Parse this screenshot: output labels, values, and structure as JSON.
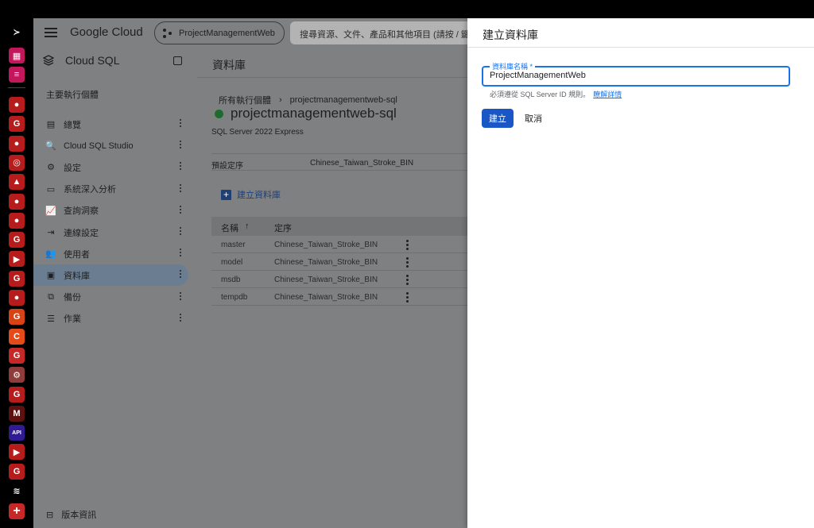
{
  "dock": {
    "items": [
      {
        "name": "sidebar-toggle-icon",
        "glyph": "≻",
        "bg": "#000000"
      },
      {
        "name": "apps-grid-icon",
        "glyph": "▦",
        "bg": "#c2185b"
      },
      {
        "name": "search-list-icon",
        "glyph": "≡",
        "bg": "#c2185b"
      },
      {
        "name": "github-icon",
        "glyph": "●",
        "bg": "#b71c1c"
      },
      {
        "name": "google-icon",
        "glyph": "G",
        "bg": "#b71c1c"
      },
      {
        "name": "github-icon",
        "glyph": "●",
        "bg": "#b71c1c"
      },
      {
        "name": "globe-icon",
        "glyph": "◎",
        "bg": "#b71c1c"
      },
      {
        "name": "cloud-drive-icon",
        "glyph": "▲",
        "bg": "#b71c1c"
      },
      {
        "name": "github-icon",
        "glyph": "●",
        "bg": "#b71c1c"
      },
      {
        "name": "github-icon",
        "glyph": "●",
        "bg": "#b71c1c"
      },
      {
        "name": "google-icon",
        "glyph": "G",
        "bg": "#b71c1c"
      },
      {
        "name": "youtube-icon",
        "glyph": "▶",
        "bg": "#b71c1c"
      },
      {
        "name": "google-icon",
        "glyph": "G",
        "bg": "#b71c1c"
      },
      {
        "name": "github-icon",
        "glyph": "●",
        "bg": "#b71c1c"
      },
      {
        "name": "g-app-icon",
        "glyph": "G",
        "bg": "#d84315"
      },
      {
        "name": "c-app-icon",
        "glyph": "C",
        "bg": "#e64a19"
      },
      {
        "name": "g-app-icon",
        "glyph": "G",
        "bg": "#c62828"
      },
      {
        "name": "settings-icon",
        "glyph": "⚙",
        "bg": "#8d3b3b"
      },
      {
        "name": "google-icon",
        "glyph": "G",
        "bg": "#b71c1c"
      },
      {
        "name": "medium-icon",
        "glyph": "M",
        "bg": "#5d1010"
      },
      {
        "name": "api-icon",
        "glyph": "API",
        "bg": "#311b92"
      },
      {
        "name": "youtube-icon",
        "glyph": "▶",
        "bg": "#b71c1c"
      },
      {
        "name": "google-icon",
        "glyph": "G",
        "bg": "#b71c1c"
      },
      {
        "name": "cloud-sql-icon",
        "glyph": "≋",
        "bg": "#000000"
      }
    ],
    "add_label": "+"
  },
  "topbar": {
    "brand": "Google Cloud",
    "project": "ProjectManagementWeb",
    "search_placeholder": "搜尋資源、文件、產品和其他項目 (請按 / 鍵)"
  },
  "sidenav": {
    "title": "Cloud SQL",
    "section": "主要執行個體",
    "items": [
      {
        "label": "總覽",
        "icon": "▤"
      },
      {
        "label": "Cloud SQL Studio",
        "icon": "🔍"
      },
      {
        "label": "設定",
        "icon": "⚙"
      },
      {
        "label": "系統深入分析",
        "icon": "▭"
      },
      {
        "label": "查詢洞察",
        "icon": "📈"
      },
      {
        "label": "連線設定",
        "icon": "⇥"
      },
      {
        "label": "使用者",
        "icon": "👥"
      },
      {
        "label": "資料庫",
        "icon": "▣"
      },
      {
        "label": "備份",
        "icon": "⧉"
      },
      {
        "label": "作業",
        "icon": "☰"
      }
    ],
    "active_index": 7,
    "footer": "版本資訊"
  },
  "main": {
    "header": "資料庫",
    "breadcrumb_root": "所有執行個體",
    "breadcrumb_sep": "›",
    "breadcrumb_current": "projectmanagementweb-sql",
    "instance_name": "projectmanagementweb-sql",
    "edition": "SQL Server 2022 Express",
    "default_collation_label": "預設定序",
    "default_collation_value": "Chinese_Taiwan_Stroke_BIN",
    "create_db_label": "建立資料庫",
    "table": {
      "col_name": "名稱",
      "sort_arrow": "↑",
      "col_collation": "定序",
      "rows": [
        {
          "name": "master",
          "collation": "Chinese_Taiwan_Stroke_BIN"
        },
        {
          "name": "model",
          "collation": "Chinese_Taiwan_Stroke_BIN"
        },
        {
          "name": "msdb",
          "collation": "Chinese_Taiwan_Stroke_BIN"
        },
        {
          "name": "tempdb",
          "collation": "Chinese_Taiwan_Stroke_BIN"
        }
      ]
    }
  },
  "panel": {
    "title": "建立資料庫",
    "field_label": "資料庫名稱 *",
    "field_value": "ProjectManagementWeb",
    "hint": "必須遵從 SQL Server ID 規則。",
    "hint_link": "瞭解詳情",
    "create_button": "建立",
    "cancel_button": "取消"
  }
}
